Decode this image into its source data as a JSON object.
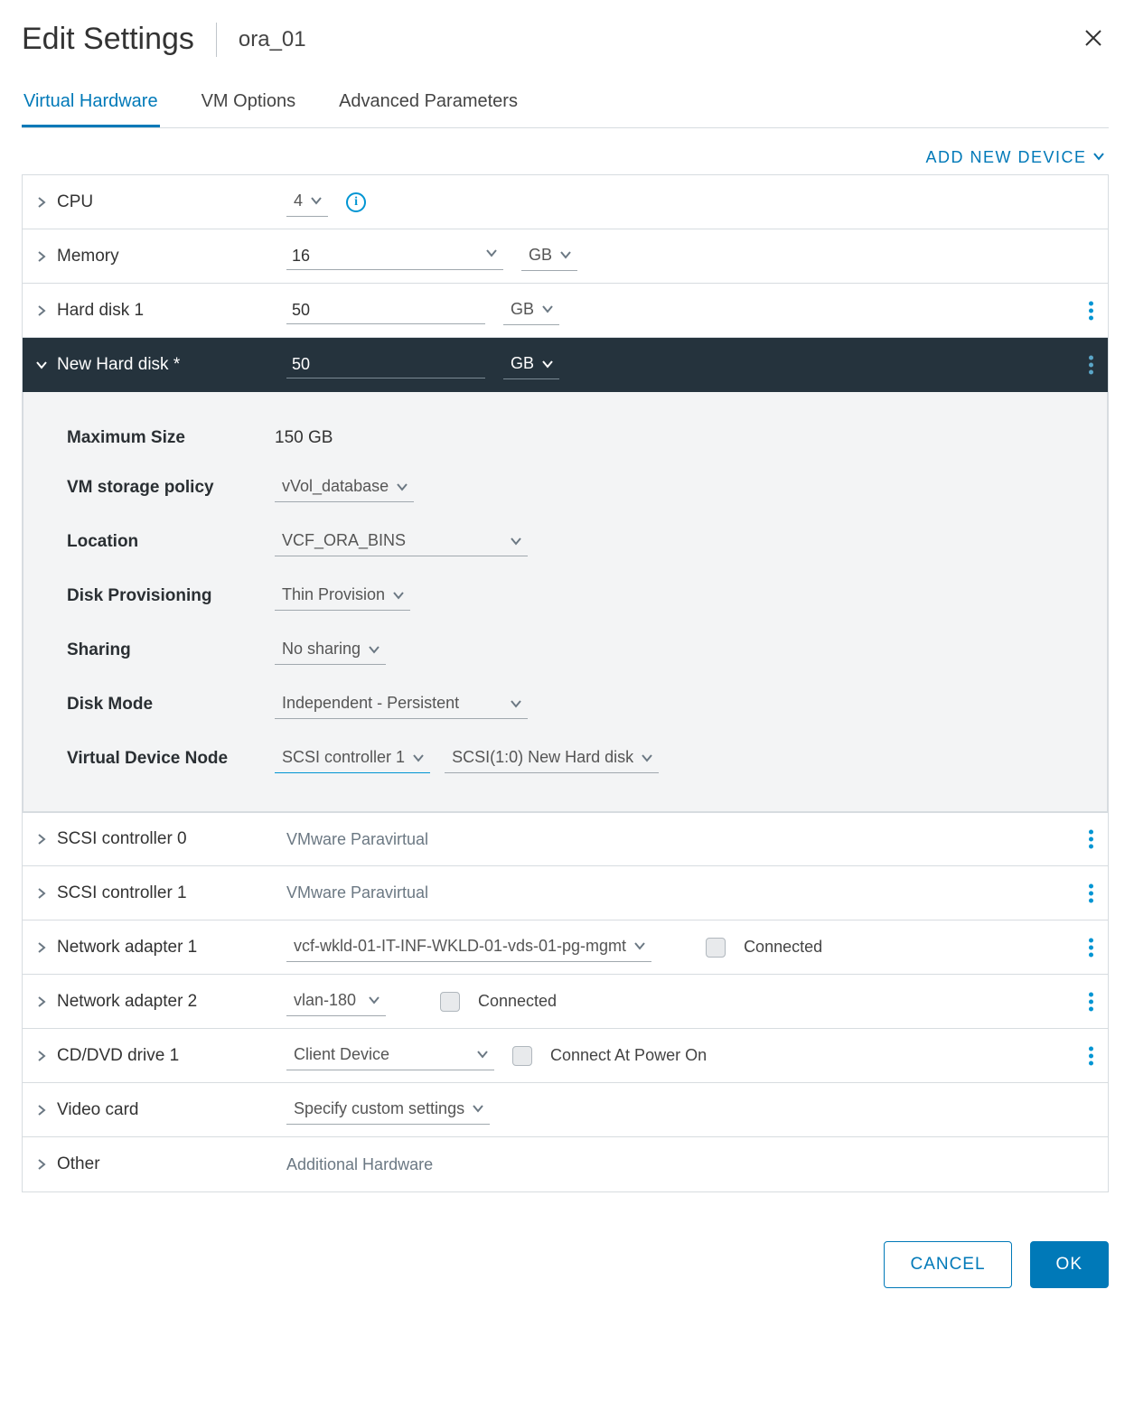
{
  "header": {
    "title": "Edit Settings",
    "vm_name": "ora_01"
  },
  "tabs": {
    "t0": "Virtual Hardware",
    "t1": "VM Options",
    "t2": "Advanced Parameters"
  },
  "add_new": "ADD NEW DEVICE",
  "rows": {
    "cpu": {
      "label": "CPU",
      "value": "4"
    },
    "memory": {
      "label": "Memory",
      "value": "16",
      "unit": "GB"
    },
    "hd1": {
      "label": "Hard disk 1",
      "value": "50",
      "unit": "GB"
    },
    "newhd": {
      "label": "New Hard disk *",
      "value": "50",
      "unit": "GB"
    },
    "scsi0": {
      "label": "SCSI controller 0",
      "value": "VMware Paravirtual"
    },
    "scsi1": {
      "label": "SCSI controller 1",
      "value": "VMware Paravirtual"
    },
    "net1": {
      "label": "Network adapter 1",
      "value": "vcf-wkld-01-IT-INF-WKLD-01-vds-01-pg-mgmt",
      "conn": "Connected"
    },
    "net2": {
      "label": "Network adapter 2",
      "value": "vlan-180",
      "conn": "Connected"
    },
    "cd": {
      "label": "CD/DVD drive 1",
      "value": "Client Device",
      "conn": "Connect At Power On"
    },
    "video": {
      "label": "Video card",
      "value": "Specify custom settings"
    },
    "other": {
      "label": "Other",
      "value": "Additional Hardware"
    }
  },
  "newhd_details": {
    "max_size": {
      "label": "Maximum Size",
      "value": "150 GB"
    },
    "policy": {
      "label": "VM storage policy",
      "value": "vVol_database"
    },
    "location": {
      "label": "Location",
      "value": "VCF_ORA_BINS"
    },
    "prov": {
      "label": "Disk Provisioning",
      "value": "Thin Provision"
    },
    "sharing": {
      "label": "Sharing",
      "value": "No sharing"
    },
    "mode": {
      "label": "Disk Mode",
      "value": "Independent - Persistent"
    },
    "vdn": {
      "label": "Virtual Device Node",
      "controller": "SCSI controller 1",
      "slot": "SCSI(1:0) New Hard disk"
    }
  },
  "footer": {
    "cancel": "CANCEL",
    "ok": "OK"
  }
}
